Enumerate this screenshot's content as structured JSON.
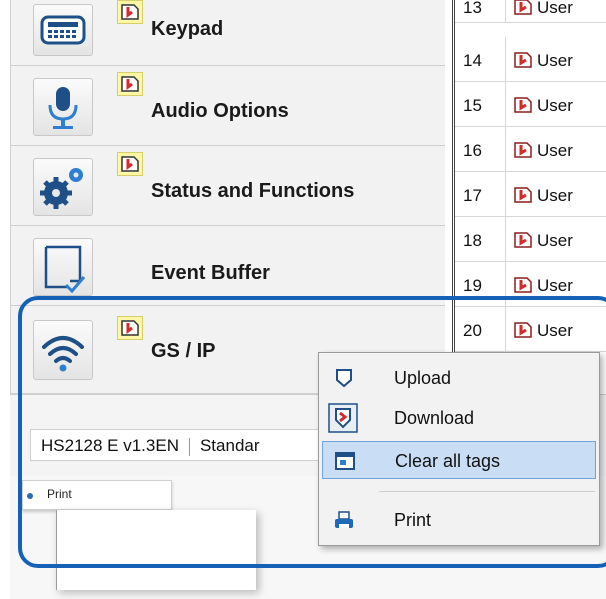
{
  "nav": {
    "items": [
      {
        "label": "Keypad",
        "icon": "keypad-icon",
        "tagged": true
      },
      {
        "label": "Audio Options",
        "icon": "microphone-icon",
        "tagged": true
      },
      {
        "label": "Status and Functions",
        "icon": "gears-icon",
        "tagged": true
      },
      {
        "label": "Event Buffer",
        "icon": "event-buffer-icon",
        "tagged": false
      },
      {
        "label": "GS / IP",
        "icon": "wifi-icon",
        "tagged": true
      }
    ]
  },
  "grid": {
    "rows": [
      {
        "num": "13",
        "text": "User"
      },
      {
        "num": "14",
        "text": "User"
      },
      {
        "num": "15",
        "text": "User"
      },
      {
        "num": "16",
        "text": "User"
      },
      {
        "num": "17",
        "text": "User"
      },
      {
        "num": "18",
        "text": "User"
      },
      {
        "num": "19",
        "text": "User"
      },
      {
        "num": "20",
        "text": "User"
      }
    ]
  },
  "statusbar": {
    "model": "HS2128 E v1.3EN",
    "mode": "Standar"
  },
  "print_dialog": {
    "label": "Print"
  },
  "context_menu": {
    "items": [
      {
        "label": "Upload",
        "icon": "upload-icon"
      },
      {
        "label": "Download",
        "icon": "download-icon"
      },
      {
        "label": "Clear all tags",
        "icon": "clear-tags-icon",
        "active": true
      },
      {
        "label": "Print",
        "icon": "print-icon"
      }
    ]
  },
  "colors": {
    "highlight": "#1561b8",
    "menu_active": "#c9def5",
    "tag_badge": "#fff7a8",
    "tag_red": "#d42a2a"
  }
}
